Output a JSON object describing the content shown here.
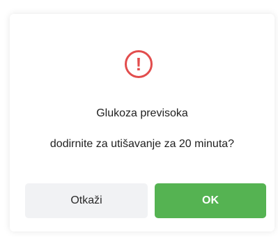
{
  "dialog": {
    "icon": "alert-exclamation-icon",
    "icon_glyph": "!",
    "title": "Glukoza previsoka",
    "message": "dodirnite za utišavanje za 20 minuta?",
    "cancel_label": "Otkaži",
    "ok_label": "OK"
  },
  "colors": {
    "alert": "#e24d4d",
    "ok_button": "#55b352",
    "cancel_button": "#f1f2f4"
  }
}
